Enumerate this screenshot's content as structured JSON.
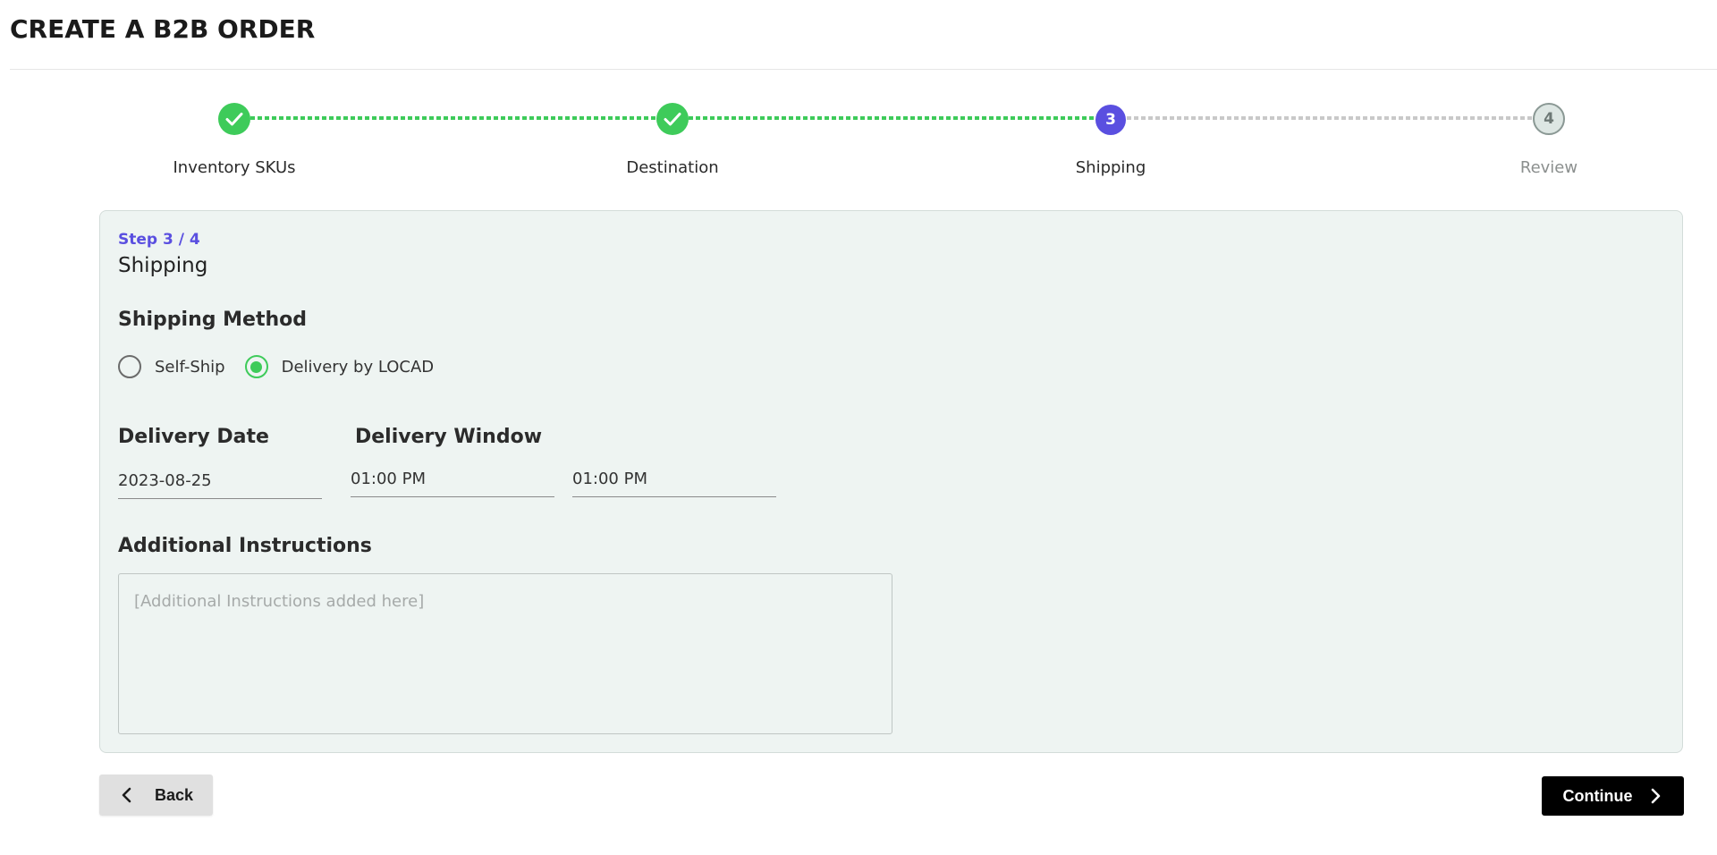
{
  "page": {
    "title": "CREATE A B2B ORDER"
  },
  "stepper": {
    "steps": [
      {
        "label": "Inventory SKUs",
        "state": "done",
        "number": "1"
      },
      {
        "label": "Destination",
        "state": "done",
        "number": "2"
      },
      {
        "label": "Shipping",
        "state": "current",
        "number": "3"
      },
      {
        "label": "Review",
        "state": "upcoming",
        "number": "4"
      }
    ]
  },
  "card": {
    "step_counter": "Step 3 / 4",
    "section_title": "Shipping",
    "shipping_method": {
      "heading": "Shipping Method",
      "options": [
        {
          "label": "Self-Ship",
          "checked": false
        },
        {
          "label": "Delivery by LOCAD",
          "checked": true
        }
      ]
    },
    "delivery_date": {
      "heading": "Delivery Date",
      "value": "2023-08-25"
    },
    "delivery_window": {
      "heading": "Delivery Window",
      "start": "01:00 PM",
      "end": "01:00 PM"
    },
    "additional_instructions": {
      "heading": "Additional Instructions",
      "placeholder": "[Additional Instructions added here]",
      "value": ""
    }
  },
  "actions": {
    "back_label": "Back",
    "continue_label": "Continue"
  },
  "colors": {
    "done_green": "#3ecb5a",
    "current_purple": "#5a4fe0",
    "card_bg": "#eef4f2",
    "continue_bg": "#000000",
    "back_bg": "#e0e0e0"
  },
  "icons": {
    "done_step": "check-icon",
    "back": "chevron-left-icon",
    "continue": "chevron-right-icon"
  }
}
